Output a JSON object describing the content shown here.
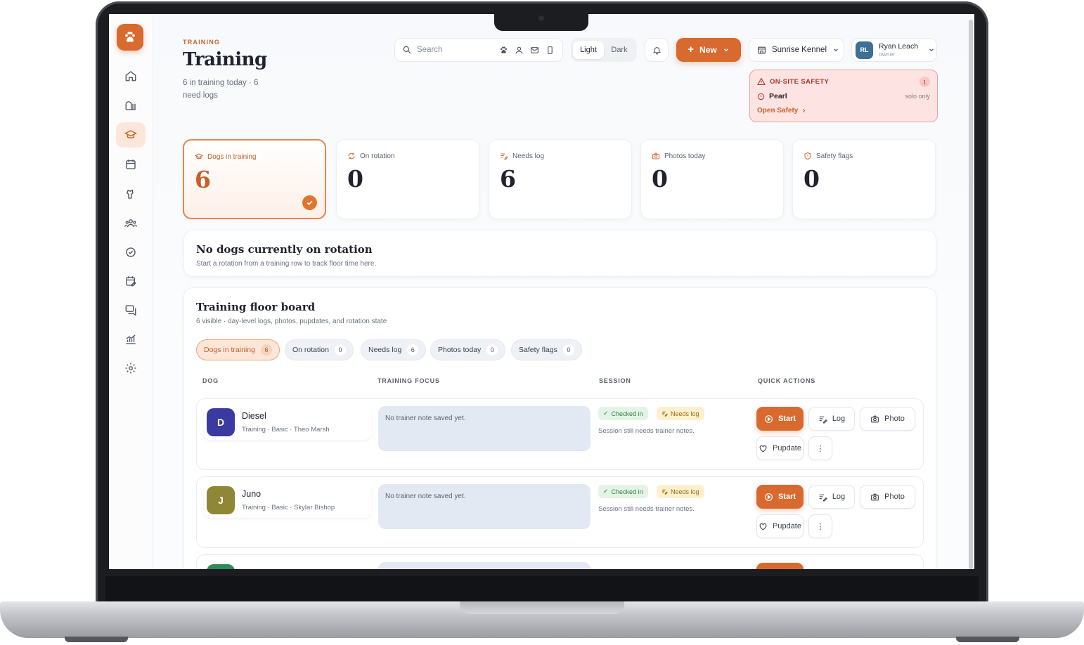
{
  "header": {
    "eyebrow": "TRAINING",
    "title": "Training",
    "subtitle": "6 in training today · 6 need logs"
  },
  "search": {
    "placeholder": "Search"
  },
  "theme": {
    "light": "Light",
    "dark": "Dark",
    "selected": "Light"
  },
  "new_button": {
    "label": "New"
  },
  "kennel": {
    "name": "Sunrise Kennel"
  },
  "user": {
    "initials": "RL",
    "name": "Ryan Leach",
    "role": "owner"
  },
  "safety": {
    "heading": "ON-SITE SAFETY",
    "count": "1",
    "dog": "Pearl",
    "note": "solo only",
    "link": "Open Safety"
  },
  "stats": [
    {
      "label": "Dogs in training",
      "value": "6",
      "active": true,
      "icon": "graduation-cap-icon"
    },
    {
      "label": "On rotation",
      "value": "0",
      "active": false,
      "icon": "rotate-icon"
    },
    {
      "label": "Needs log",
      "value": "6",
      "active": false,
      "icon": "log-edit-icon"
    },
    {
      "label": "Photos today",
      "value": "0",
      "active": false,
      "icon": "camera-icon"
    },
    {
      "label": "Safety flags",
      "value": "0",
      "active": false,
      "icon": "shield-icon"
    }
  ],
  "rotation": {
    "title": "No dogs currently on rotation",
    "subtitle": "Start a rotation from a training row to track floor time here."
  },
  "board": {
    "title": "Training floor board",
    "subtitle": "6 visible · day-level logs, photos, pupdates, and rotation state",
    "filters": [
      {
        "label": "Dogs in training",
        "count": "6",
        "active": true
      },
      {
        "label": "On rotation",
        "count": "0",
        "active": false
      },
      {
        "label": "Needs log",
        "count": "6",
        "active": false
      },
      {
        "label": "Photos today",
        "count": "0",
        "active": false
      },
      {
        "label": "Safety flags",
        "count": "0",
        "active": false
      }
    ],
    "columns": [
      "DOG",
      "TRAINING FOCUS",
      "SESSION",
      "QUICK ACTIONS"
    ],
    "rows": [
      {
        "initial": "D",
        "name": "Diesel",
        "meta": "Training · Basic · Theo Marsh",
        "avatar_color": "#3b3aa0",
        "note": "No trainer note saved yet.",
        "status_checked": "Checked in",
        "status_log": "Needs log",
        "session_note": "Session still needs trainer notes."
      },
      {
        "initial": "J",
        "name": "Juno",
        "meta": "Training · Basic · Skylar Bishop",
        "avatar_color": "#8f8735",
        "note": "No trainer note saved yet.",
        "status_checked": "Checked in",
        "status_log": "Needs log",
        "session_note": "Session still needs trainer notes."
      }
    ],
    "actions": {
      "start": "Start",
      "log": "Log",
      "photo": "Photo",
      "pupdate": "Pupdate",
      "more": "⋮"
    }
  },
  "colors": {
    "accent": "#d86a30",
    "safety_bg": "#fde4e2",
    "safety_text": "#b33328"
  }
}
